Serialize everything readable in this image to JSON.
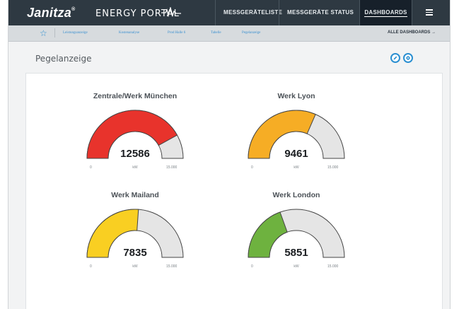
{
  "topbar": {
    "brand": "Janitza",
    "brand_mark": "®",
    "portal": "ENERGY PORTAL",
    "nav": [
      {
        "label": "MESSGERÄTELISTE"
      },
      {
        "label": "MESSGERÄTE STATUS"
      },
      {
        "label": "DASHBOARDS"
      }
    ],
    "menu_icon": "hamburger-icon"
  },
  "subnav": {
    "favorite_icon": "star-icon",
    "links": [
      "Leistungsanzeige",
      "Kostenanalyse",
      "Prod Halle 6",
      "Tabelle",
      "Pegelanzeige"
    ],
    "all_dashboards": "ALLE DASHBOARDS →"
  },
  "page": {
    "title": "Pegelanzeige",
    "edit_icon": "pencil-icon",
    "settings_icon": "settings-icon"
  },
  "colors": {
    "red": "#e8332c",
    "orange": "#f6ad25",
    "yellow": "#f9cf22",
    "green": "#6eb23f",
    "track": "#e5e5e5",
    "accent": "#2b8fd1"
  },
  "gauges": [
    {
      "title": "Zentrale/Werk München",
      "value": "12586",
      "value_num": 12586,
      "unit": "kW",
      "min": "0",
      "max": "15.000",
      "max_num": 15000,
      "color": "#e8332c"
    },
    {
      "title": "Werk Lyon",
      "value": "9461",
      "value_num": 9461,
      "unit": "kW",
      "min": "0",
      "max": "15.000",
      "max_num": 15000,
      "color": "#f6ad25"
    },
    {
      "title": "Werk Mailand",
      "value": "7835",
      "value_num": 7835,
      "unit": "kW",
      "min": "0",
      "max": "15.000",
      "max_num": 15000,
      "color": "#f9cf22"
    },
    {
      "title": "Werk London",
      "value": "5851",
      "value_num": 5851,
      "unit": "kW",
      "min": "0",
      "max": "15.000",
      "max_num": 15000,
      "color": "#6eb23f"
    }
  ]
}
